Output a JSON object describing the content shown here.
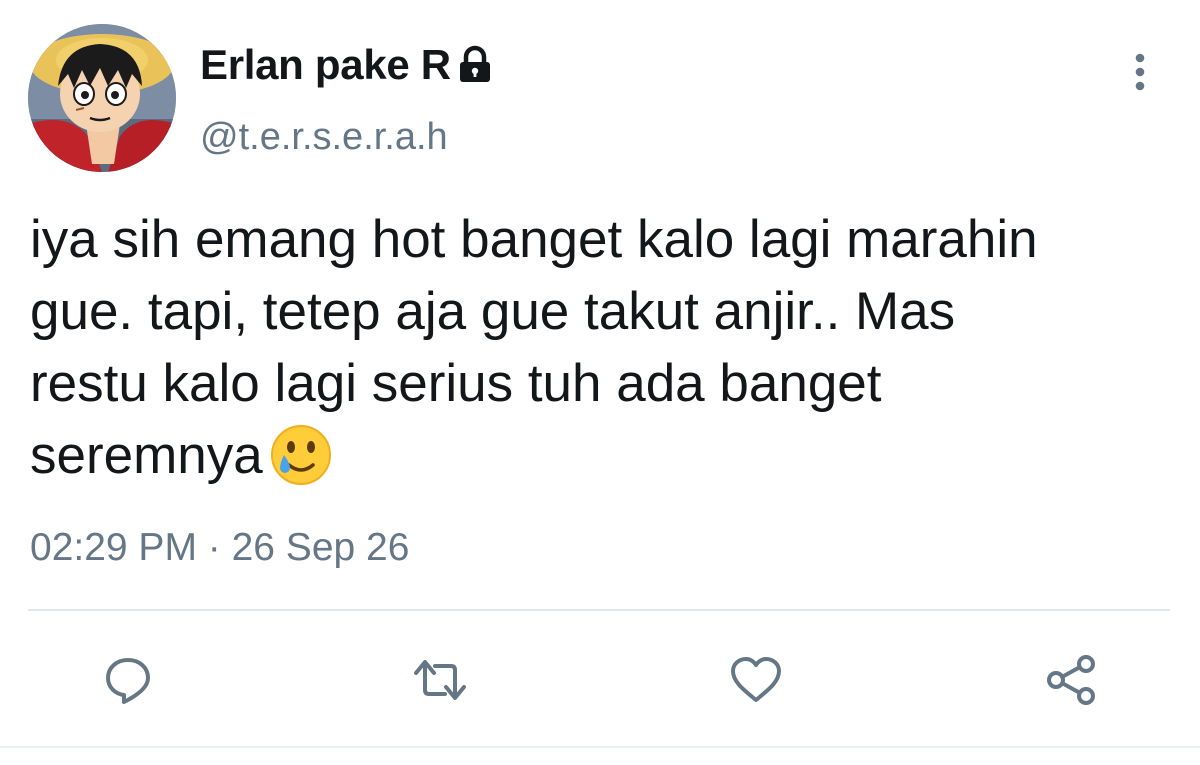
{
  "tweet": {
    "display_name": "Erlan pake R",
    "handle": "@t.e.r.s.e.r.a.h",
    "text": "iya sih emang hot banget kalo lagi marahin\ngue. tapi, tetep aja gue takut anjir.. Mas\nrestu kalo lagi serius tuh ada banget\nseremnya",
    "timestamp": "02:29 PM · 26 Sep 26",
    "emoji": "smiling-face-with-tear"
  },
  "icons": {
    "lock": "lock-icon",
    "more": "vertical-ellipsis-icon",
    "reply": "reply-bubble-icon",
    "retweet": "retweet-icon",
    "like": "heart-icon",
    "share": "share-icon"
  },
  "colors": {
    "text_primary": "#14171a",
    "text_secondary": "#657786",
    "icon_gray": "#657786",
    "divider": "#e1e8ed"
  }
}
